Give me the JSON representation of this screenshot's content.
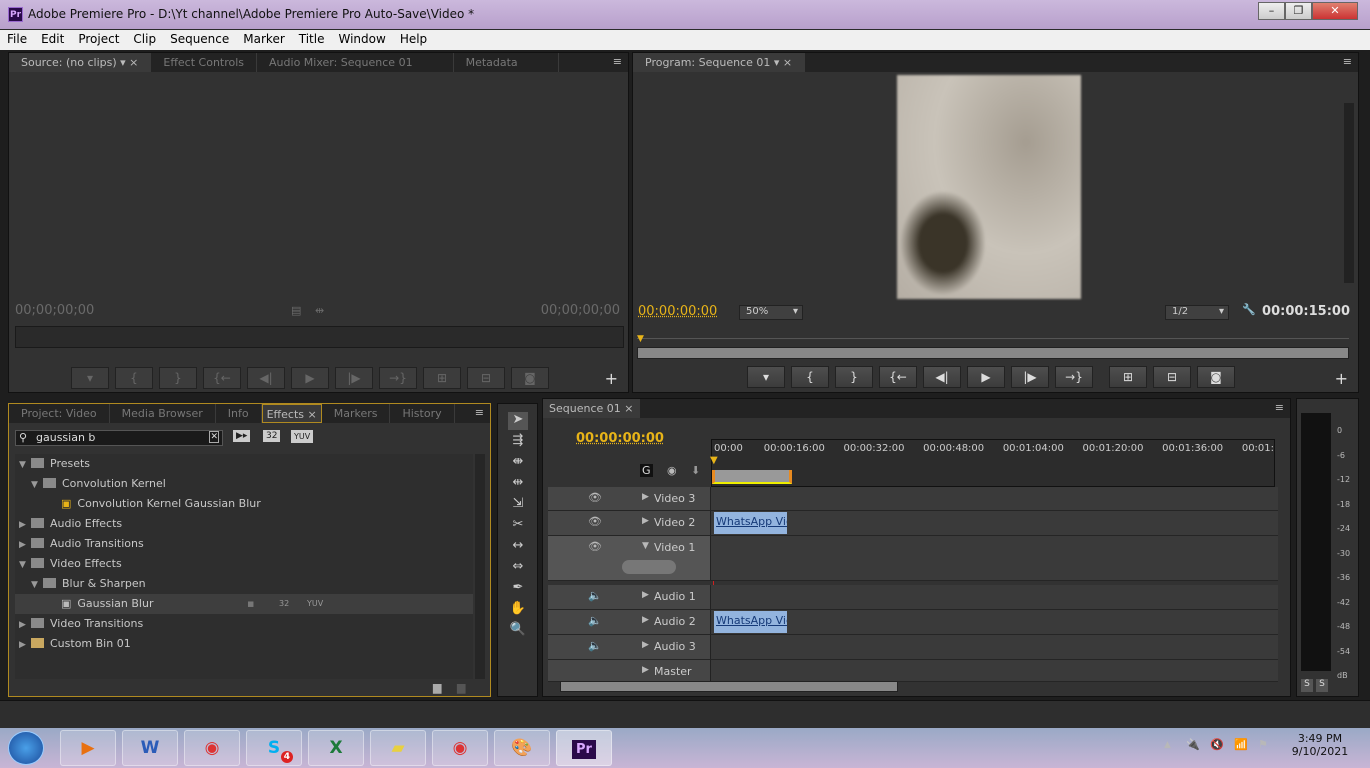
{
  "window": {
    "title": "Adobe Premiere Pro - D:\\Yt channel\\Adobe Premiere Pro Auto-Save\\Video *",
    "app_icon": "Pr",
    "controls": [
      "minimize",
      "restore",
      "close"
    ]
  },
  "menu": [
    "File",
    "Edit",
    "Project",
    "Clip",
    "Sequence",
    "Marker",
    "Title",
    "Window",
    "Help"
  ],
  "source_panel": {
    "tabs": [
      "Source: (no clips)",
      "Effect Controls",
      "Audio Mixer: Sequence 01",
      "Metadata"
    ],
    "timecode_in": "00;00;00;00",
    "timecode_out": "00;00;00;00"
  },
  "program_panel": {
    "tab": "Program: Sequence 01",
    "timecode": "00:00:00:00",
    "zoom": "50%",
    "resolution": "1/2",
    "duration": "00:00:15:00"
  },
  "project_panel": {
    "tabs": [
      "Project: Video",
      "Media Browser",
      "Info",
      "Effects",
      "Markers",
      "History"
    ],
    "active_tab": "Effects",
    "search_value": "gaussian b",
    "badges": [
      "32",
      "YUV"
    ],
    "tree": [
      {
        "label": "Presets",
        "level": 0,
        "expanded": true
      },
      {
        "label": "Convolution Kernel",
        "level": 1,
        "expanded": true
      },
      {
        "label": "Convolution Kernel Gaussian Blur",
        "level": 2,
        "item": true
      },
      {
        "label": "Audio Effects",
        "level": 0
      },
      {
        "label": "Audio Transitions",
        "level": 0
      },
      {
        "label": "Video Effects",
        "level": 0,
        "expanded": true
      },
      {
        "label": "Blur & Sharpen",
        "level": 1,
        "expanded": true
      },
      {
        "label": "Gaussian Blur",
        "level": 2,
        "item": true,
        "selected": true
      },
      {
        "label": "Video Transitions",
        "level": 0
      },
      {
        "label": "Custom Bin 01",
        "level": 0
      }
    ]
  },
  "timeline": {
    "tab": "Sequence 01",
    "timecode": "00:00:00:00",
    "ruler": [
      "00:00",
      "00:00:16:00",
      "00:00:32:00",
      "00:00:48:00",
      "00:01:04:00",
      "00:01:20:00",
      "00:01:36:00",
      "00:01:"
    ],
    "tracks": [
      "Video 3",
      "Video 2",
      "Video 1",
      "Audio 1",
      "Audio 2",
      "Audio 3",
      "Master"
    ],
    "clip_label": "WhatsApp Vid"
  },
  "audio_meter": {
    "scale": [
      "0",
      "-6",
      "-12",
      "-18",
      "-24",
      "-30",
      "-36",
      "-42",
      "-48",
      "-54",
      "dB"
    ],
    "solo": [
      "S",
      "S"
    ]
  },
  "taskbar": {
    "apps": [
      "Windows Media Player",
      "Word",
      "Chrome",
      "Skype",
      "Excel",
      "Sticky Notes",
      "Chrome",
      "Paint",
      "Premiere Pro"
    ],
    "skype_badge": "4",
    "time": "3:49 PM",
    "date": "9/10/2021"
  }
}
